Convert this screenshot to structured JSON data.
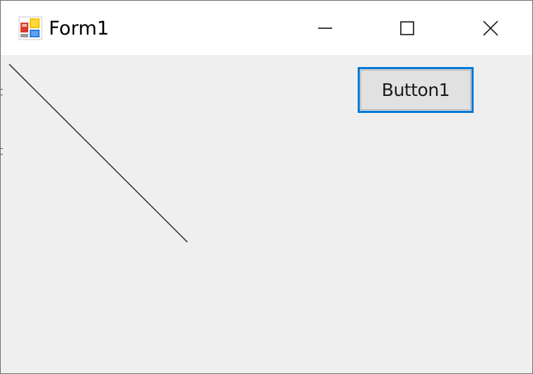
{
  "window": {
    "title": "Form1",
    "icon": "winforms-app-icon",
    "controls": {
      "minimize_icon": "minimize-icon",
      "maximize_icon": "maximize-icon",
      "close_icon": "close-icon"
    }
  },
  "form": {
    "button1_label": "Button1",
    "drawn_line_color": "#3c3c3c"
  },
  "colors": {
    "client_background": "#efefef",
    "button_focus_border": "#0078d7",
    "button_face": "#e1e1e1"
  }
}
